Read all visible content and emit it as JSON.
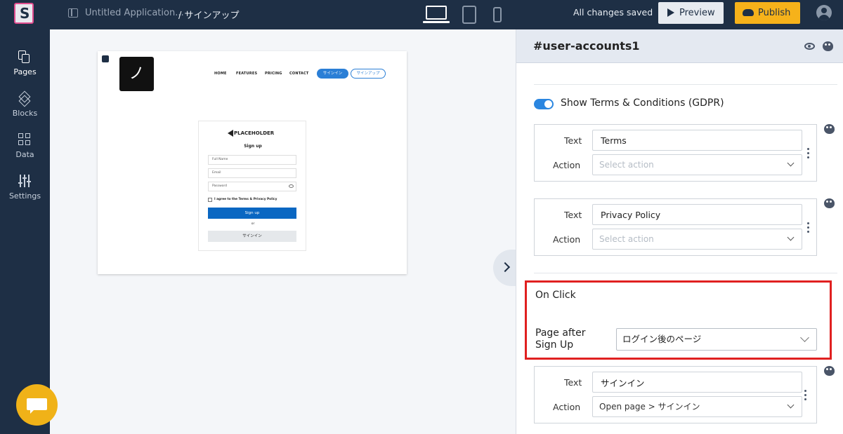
{
  "topbar": {
    "logo_letter": "S",
    "app_title": "Untitled Application...",
    "page_crumb": "/ サインアップ",
    "saved_status": "All changes saved",
    "preview_label": "Preview",
    "publish_label": "Publish"
  },
  "leftnav": {
    "items": [
      {
        "label": "Pages",
        "icon": "pages-icon"
      },
      {
        "label": "Blocks",
        "icon": "blocks-icon"
      },
      {
        "label": "Data",
        "icon": "data-icon"
      },
      {
        "label": "Settings",
        "icon": "settings-icon"
      }
    ]
  },
  "preview": {
    "logo_glyph": "ノ",
    "nav": [
      "HOME",
      "FEATURES",
      "PRICING",
      "CONTACT"
    ],
    "signin_btn": "サインイン",
    "signup_btn": "サインアップ",
    "card": {
      "brand": "PLACEHOLDER",
      "title": "Sign up",
      "fields": [
        "Full Name",
        "Email",
        "Password"
      ],
      "terms": "I agree to the Terms & Privacy Policy",
      "submit": "Sign up",
      "or": "or",
      "alt": "サインイン"
    }
  },
  "panel": {
    "title": "#user-accounts1",
    "gdpr_toggle_label": "Show Terms & Conditions (GDPR)",
    "gdpr_enabled": true,
    "groups": [
      {
        "text_label": "Text",
        "text_value": "Terms",
        "action_label": "Action",
        "action_value": "Select action"
      },
      {
        "text_label": "Text",
        "text_value": "Privacy Policy",
        "action_label": "Action",
        "action_value": "Select action"
      },
      {
        "text_label": "Text",
        "text_value": "サインイン",
        "action_label": "Action",
        "action_value": "Open page > サインイン"
      }
    ],
    "on_click": {
      "title": "On Click",
      "page_after_label": "Page after Sign Up",
      "page_after_value": "ログイン後のページ"
    }
  },
  "colors": {
    "sidebar": "#1e2f45",
    "publish": "#f6b21a",
    "accent_blue": "#2b86e0",
    "highlight_red": "#e02020",
    "chat": "#f0b218"
  }
}
